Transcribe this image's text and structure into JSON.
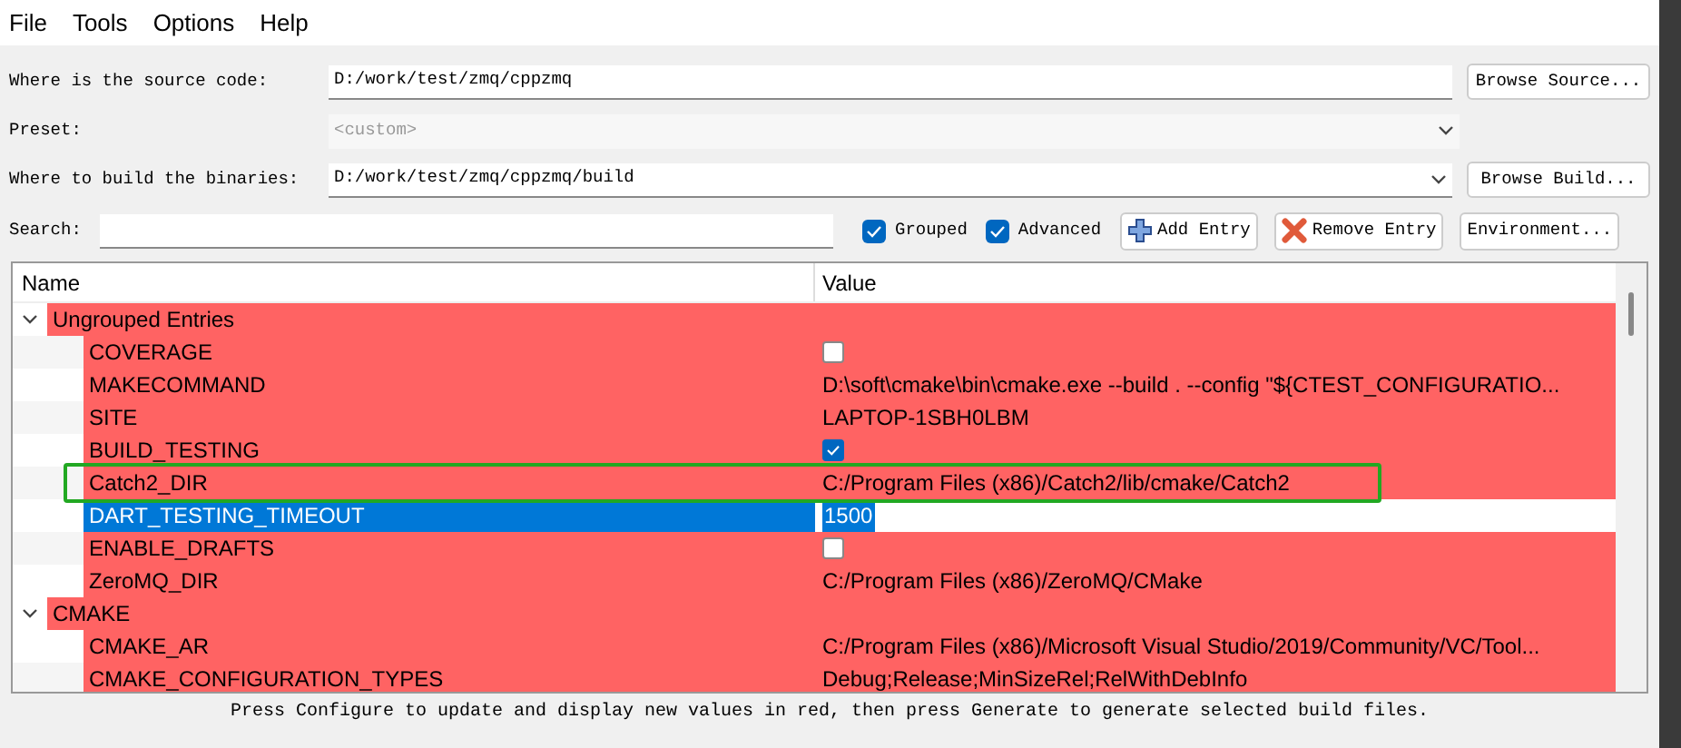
{
  "menu": [
    "File",
    "Tools",
    "Options",
    "Help"
  ],
  "source": {
    "label": "Where is the source code:",
    "value": "D:/work/test/zmq/cppzmq",
    "button": "Browse Source..."
  },
  "preset": {
    "label": "Preset:",
    "placeholder": "<custom>",
    "disabled": true
  },
  "build": {
    "label": "Where to build the binaries:",
    "value": "D:/work/test/zmq/cppzmq/build",
    "button": "Browse Build..."
  },
  "search": {
    "label": "Search:"
  },
  "options": [
    {
      "label": "Grouped",
      "checked": true
    },
    {
      "label": "Advanced",
      "checked": true
    }
  ],
  "buttons": [
    {
      "kind": "add",
      "label": "Add Entry"
    },
    {
      "kind": "remove",
      "label": "Remove Entry"
    },
    {
      "kind": "plain",
      "label": "Environment..."
    }
  ],
  "table": {
    "columns": [
      "Name",
      "Value"
    ],
    "groups": [
      {
        "label": "Ungrouped Entries",
        "expanded": true,
        "children": [
          {
            "name": "COVERAGE",
            "kind": "bool",
            "checked": false,
            "selected": false
          },
          {
            "name": "MAKECOMMAND",
            "kind": "text",
            "value": "D:\\soft\\cmake\\bin\\cmake.exe --build . --config \"${CTEST_CONFIGURATIO...",
            "selected": false
          },
          {
            "name": "SITE",
            "kind": "text",
            "value": "LAPTOP-1SBH0LBM",
            "selected": false
          },
          {
            "name": "BUILD_TESTING",
            "kind": "bool",
            "checked": true,
            "selected": false
          },
          {
            "name": "Catch2_DIR",
            "kind": "text",
            "value": "C:/Program Files (x86)/Catch2/lib/cmake/Catch2",
            "selected": false
          },
          {
            "name": "DART_TESTING_TIMEOUT",
            "kind": "text",
            "value": "1500",
            "selected": true
          },
          {
            "name": "ENABLE_DRAFTS",
            "kind": "bool",
            "checked": false,
            "selected": false
          },
          {
            "name": "ZeroMQ_DIR",
            "kind": "text",
            "value": "C:/Program Files (x86)/ZeroMQ/CMake",
            "selected": false
          }
        ]
      },
      {
        "label": "CMAKE",
        "expanded": true,
        "children": [
          {
            "name": "CMAKE_AR",
            "kind": "text",
            "value": "C:/Program Files (x86)/Microsoft Visual Studio/2019/Community/VC/Tool...",
            "selected": false
          },
          {
            "name": "CMAKE_CONFIGURATION_TYPES",
            "kind": "text",
            "value": "Debug;Release;MinSizeRel;RelWithDebInfo",
            "selected": false
          }
        ]
      }
    ]
  },
  "status": "Press Configure to update and display new values in red, then press Generate to generate selected build files."
}
